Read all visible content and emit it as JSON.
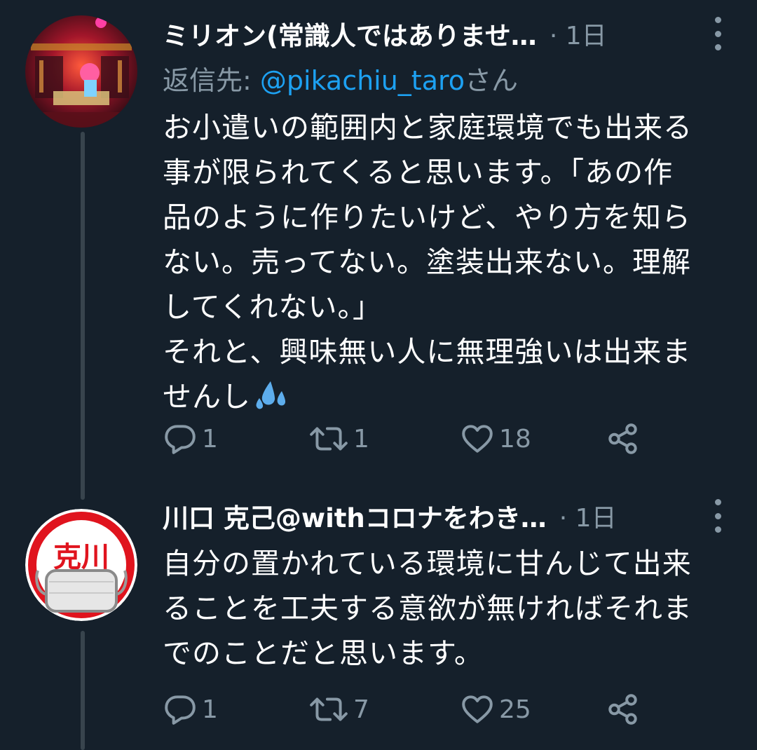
{
  "tweets": [
    {
      "display_name": "ミリオン(常識人ではありませ…",
      "time": "· 1日",
      "reply_label": "返信先: ",
      "reply_mention": "@pikachiu_taro",
      "reply_suffix": "さん",
      "text": "お小遣いの範囲内と家庭環境でも出来る\n事が限られてくると思います。「あの作\n品のように作りたいけど、やり方を知ら\nない。売ってない。塗装出来ない。理解\nしてくれない。」\nそれと、興味無い人に無理強いは出来ま\nせんし",
      "emoji": "sweat-droplets",
      "replies": "1",
      "retweets": "1",
      "likes": "18"
    },
    {
      "display_name": "川口 克己@withコロナをわき…",
      "time": "· 1日",
      "text": "自分の置かれている環境に甘んじて出来\nることを工夫する意欲が無ければそれま\nでのことだと思います。",
      "replies": "1",
      "retweets": "7",
      "likes": "25"
    }
  ],
  "avatar_2_glyphs": "克川",
  "icons": {
    "reply": "speech-bubble-icon",
    "retweet": "retweet-arrows-icon",
    "like": "heart-icon",
    "share": "share-nodes-icon",
    "more": "vertical-dots-icon"
  },
  "colors": {
    "background": "#15202b",
    "text": "#ffffff",
    "secondary": "#8899a6",
    "link": "#1da1f2",
    "thread_line": "#38444d"
  }
}
